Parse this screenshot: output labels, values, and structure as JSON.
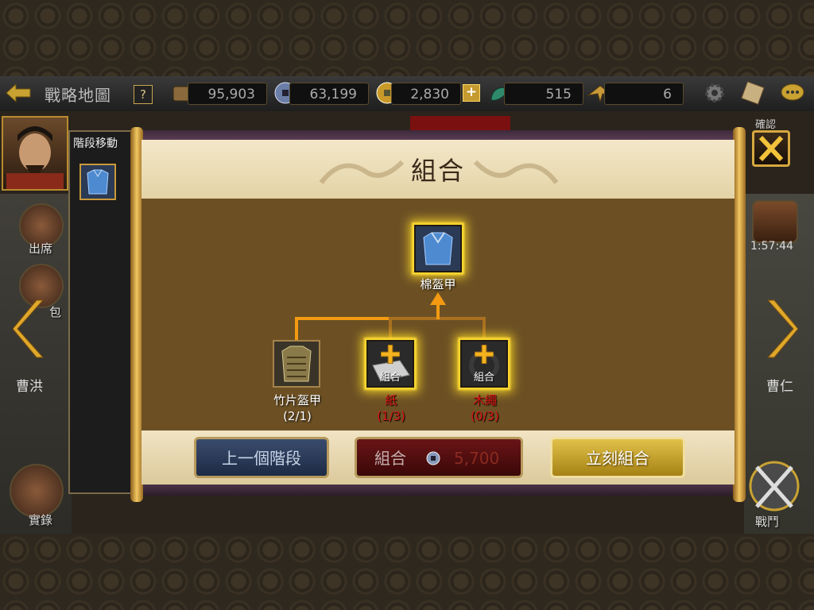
{
  "topbar": {
    "title": "戰略地圖",
    "help": "?",
    "resources": [
      {
        "icon": "scroll-icon",
        "value": "95,903"
      },
      {
        "icon": "silver-coin-icon",
        "value": "63,199"
      },
      {
        "icon": "gold-coin-icon",
        "value": "2,830"
      },
      {
        "icon": "jade-icon",
        "value": "515"
      },
      {
        "icon": "eagle-icon",
        "value": "6"
      }
    ],
    "plus": "+"
  },
  "left_sidebar": {
    "attend_label": "出席",
    "bag_label": "包",
    "record_label": "實錄",
    "hero_name": "曹洪"
  },
  "right_sidebar": {
    "timer": "1:57:44",
    "battle_label": "戰鬥",
    "hero_name": "曹仁",
    "confirm_label": "確認"
  },
  "stage_panel": {
    "title": "階段移動"
  },
  "dialog": {
    "title": "組合",
    "result_item": {
      "name": "棉盔甲"
    },
    "ingredients": [
      {
        "name": "竹片盔甲",
        "count": "(2/1)",
        "combine": ""
      },
      {
        "name": "紙",
        "count": "(1/3)",
        "combine": "組合"
      },
      {
        "name": "木繩",
        "count": "(0/3)",
        "combine": "組合"
      }
    ],
    "buttons": {
      "prev_stage": "上一個階段",
      "combine": "組合",
      "combine_cost": "5,700",
      "instant_combine": "立刻組合"
    }
  },
  "colors": {
    "accent_gold": "#f1c760",
    "connector_orange": "#f39a12",
    "requirement_red": "#d81414"
  }
}
